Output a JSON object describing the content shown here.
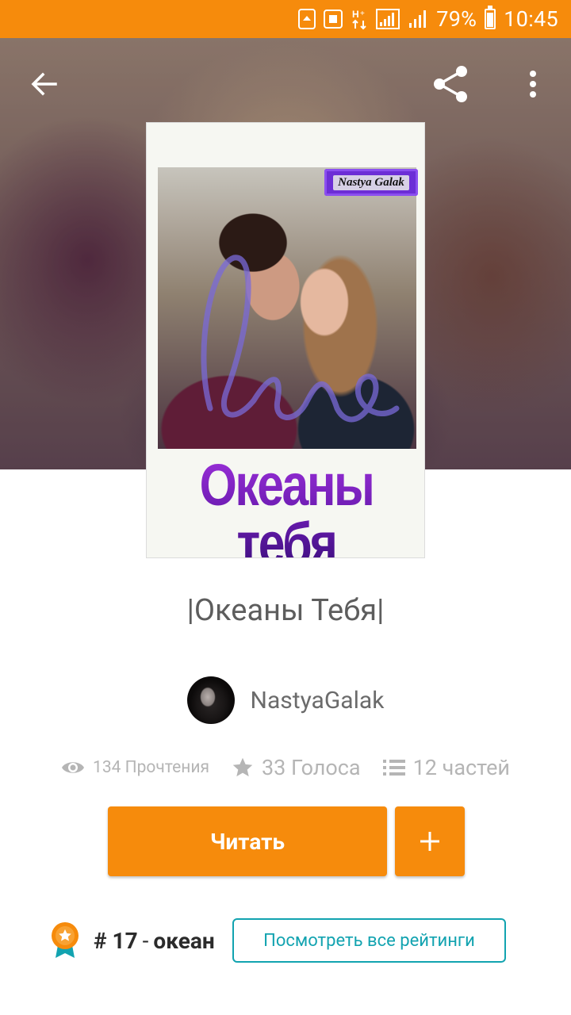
{
  "status_bar": {
    "battery_percent": "79%",
    "time": "10:45",
    "network": "H+",
    "background_color": "#f68b0c"
  },
  "toolbar": {
    "back_icon": "arrow-left-icon",
    "share_icon": "share-icon",
    "more_icon": "more-vertical-icon"
  },
  "cover": {
    "badge_text": "Nastya Galak",
    "script_text": "love",
    "title_text": "Океаны тебя"
  },
  "story": {
    "title": "|Океаны Тебя|",
    "author": "NastyaGalak"
  },
  "stats": {
    "reads": "134 Прочтения",
    "votes": "33 Голоса",
    "parts": "12 частей"
  },
  "actions": {
    "read_label": "Читать",
    "add_label": "+"
  },
  "ranking": {
    "rank": "# 17",
    "separator": "-",
    "tag": "океан",
    "view_all_label": "Посмотреть все рейтинги"
  },
  "colors": {
    "accent": "#f68b0c",
    "link": "#12a3b0"
  }
}
